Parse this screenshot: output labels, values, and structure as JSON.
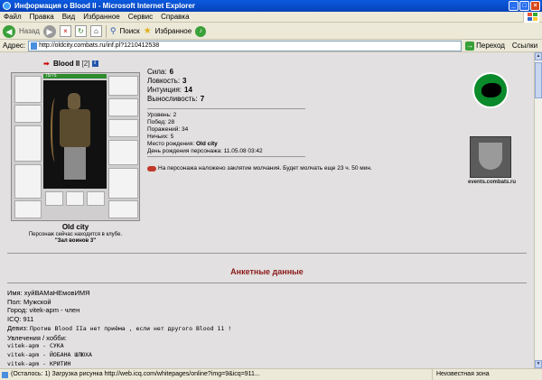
{
  "window": {
    "title": "Информация о Blood II - Microsoft Internet Explorer"
  },
  "menu": [
    "Файл",
    "Правка",
    "Вид",
    "Избранное",
    "Сервис",
    "Справка"
  ],
  "toolbar": {
    "back": "Назад",
    "search": "Поиск",
    "favorites": "Избранное"
  },
  "address": {
    "label": "Адрес:",
    "url": "http://oldcity.combats.ru/inf.pl?1210412538",
    "go": "Переход",
    "links": "Ссылки"
  },
  "character": {
    "name": "Blood II",
    "level": "[2]",
    "hp": "75/75",
    "city": "Old city",
    "club_note": "Персонаж сейчас находится в клубе.",
    "club": "\"Зал воинов 3\""
  },
  "stats": [
    {
      "label": "Сила:",
      "value": "6"
    },
    {
      "label": "Ловкость:",
      "value": "3"
    },
    {
      "label": "Интуиция:",
      "value": "14"
    },
    {
      "label": "Выносливость:",
      "value": "7"
    }
  ],
  "facts": [
    {
      "label": "Уровень:",
      "value": "2"
    },
    {
      "label": "Побед:",
      "value": "28"
    },
    {
      "label": "Поражений:",
      "value": "34"
    },
    {
      "label": "Ничьих:",
      "value": "5"
    },
    {
      "label": "Место рождения:",
      "value": "Old city"
    },
    {
      "label": "День рождения персонажа:",
      "value": "11.05.08 03:42"
    }
  ],
  "silence_notice": "На персонажа наложено заклятие молчания. Будет молчать еще 23 ч. 50 мин.",
  "events_link": "events.combats.ru",
  "profile": {
    "title": "Анкетные данные",
    "name_label": "Имя:",
    "name": "хуйВАМаНЕмовИМЯ",
    "gender_label": "Пол:",
    "gender": "Мужской",
    "city_label": "Город:",
    "city": "vitek-apm - член",
    "icq_label": "ICQ:",
    "icq": "911",
    "motto_label": "Девиз:",
    "motto": "Против Blood IIа нет приёма , если нет другого Blood 11 !",
    "hobbies_label": "Увлечения / хобби:",
    "hobbies": [
      "vitek-apm - СУКА",
      "vitek-apm - ЙОБАНА ШЛЮХА",
      "vitek-apm - КРИТИН"
    ]
  },
  "status": {
    "text": "(Осталось: 1) Загрузка рисунка http://web.icq.com/whitepages/online?img=9&icq=911...",
    "zone": "Неизвестная зона"
  }
}
